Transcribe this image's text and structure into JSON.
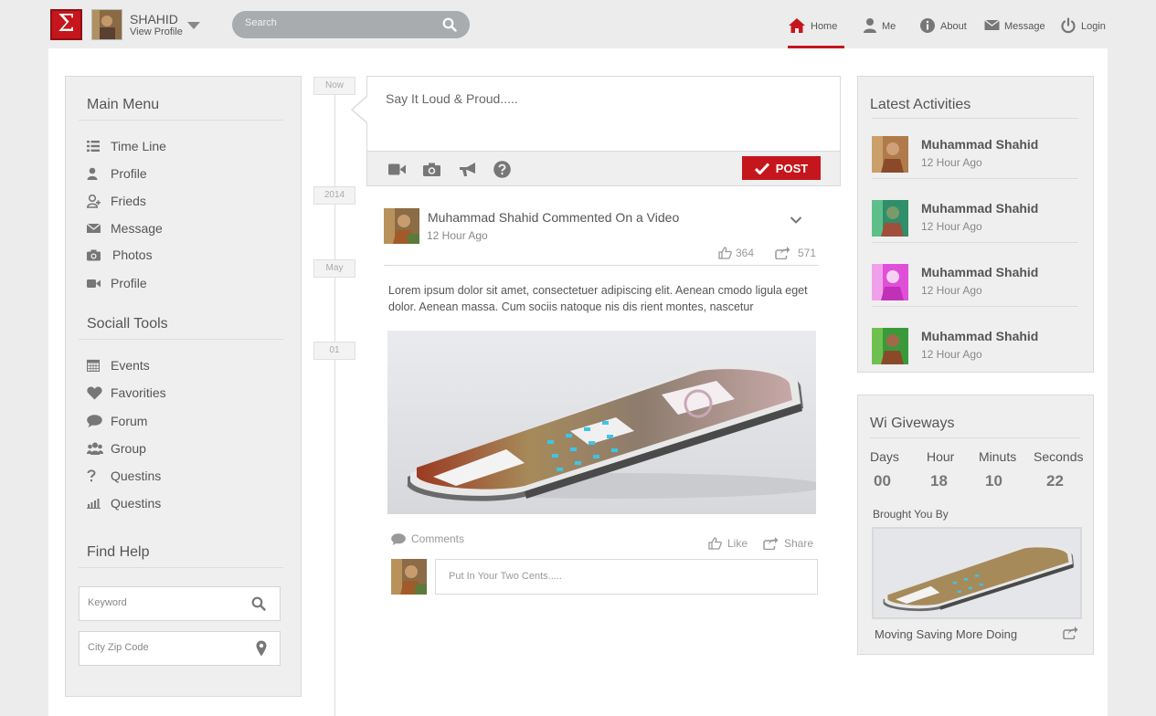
{
  "header": {
    "logo_glyph": "Σ",
    "user_name": "SHAHID",
    "user_link": "View Profile",
    "search_placeholder": "Search",
    "nav": [
      {
        "label": "Home",
        "icon": "home-icon",
        "active": true
      },
      {
        "label": "Me",
        "icon": "user-icon"
      },
      {
        "label": "About",
        "icon": "info-icon"
      },
      {
        "label": "Message",
        "icon": "envelope-icon"
      },
      {
        "label": "Login",
        "icon": "power-icon"
      }
    ]
  },
  "sidebar": {
    "main_menu_title": "Main Menu",
    "main_menu": [
      {
        "label": "Time Line",
        "icon": "list-icon"
      },
      {
        "label": "Profile",
        "icon": "user-icon"
      },
      {
        "label": "Frieds",
        "icon": "friends-icon"
      },
      {
        "label": "Message",
        "icon": "envelope-icon"
      },
      {
        "label": "Photos",
        "icon": "camera-icon"
      },
      {
        "label": "Profile",
        "icon": "video-icon"
      }
    ],
    "tools_title": "Sociall Tools",
    "tools": [
      {
        "label": "Events",
        "icon": "calendar-icon"
      },
      {
        "label": "Favorities",
        "icon": "heart-icon"
      },
      {
        "label": "Forum",
        "icon": "comment-icon"
      },
      {
        "label": "Group",
        "icon": "group-icon"
      },
      {
        "label": "Questins",
        "icon": "question-icon"
      },
      {
        "label": "Questins",
        "icon": "bar-chart-icon"
      }
    ],
    "find_help_title": "Find Help",
    "keyword_placeholder": "Keyword",
    "zip_placeholder": "City Zip Code"
  },
  "timeline": {
    "badges": [
      "Now",
      "2014",
      "May",
      "01"
    ]
  },
  "composer": {
    "placeholder": "Say It Loud & Proud.....",
    "post_label": "POST",
    "tools": [
      "video-icon",
      "camera-icon",
      "megaphone-icon",
      "question-circle-icon"
    ]
  },
  "post": {
    "title": "Muhammad Shahid Commented On a Video",
    "time": "12 Hour Ago",
    "likes": "364",
    "shares": "571",
    "text": "Lorem ipsum dolor sit amet, consectetuer adipiscing elit. Aenean cmodo ligula eget dolor. Aenean massa. Cum sociis natoque nis dis rient montes, nascetur",
    "comments_label": "Comments",
    "like_label": "Like",
    "share_label": "Share",
    "comment_placeholder": "Put In Your Two Cents....."
  },
  "activities": {
    "title": "Latest Activities",
    "items": [
      {
        "name": "Muhammad Shahid",
        "time": "12 Hour Ago",
        "tint": "#b07a4a"
      },
      {
        "name": "Muhammad Shahid",
        "time": "12 Hour Ago",
        "tint": "#2f8f6a"
      },
      {
        "name": "Muhammad Shahid",
        "time": "12 Hour Ago",
        "tint": "#e04fd8"
      },
      {
        "name": "Muhammad Shahid",
        "time": "12 Hour Ago",
        "tint": "#3a9a3a"
      }
    ]
  },
  "giveaways": {
    "title": "Wi Giveways",
    "labels": [
      "Days",
      "Hour",
      "Minuts",
      "Seconds"
    ],
    "values": [
      "00",
      "18",
      "10",
      "22"
    ],
    "brought_by": "Brought You By",
    "caption": "Moving Saving More Doing"
  },
  "colors": {
    "accent": "#c4161c",
    "panel": "#efefef"
  }
}
